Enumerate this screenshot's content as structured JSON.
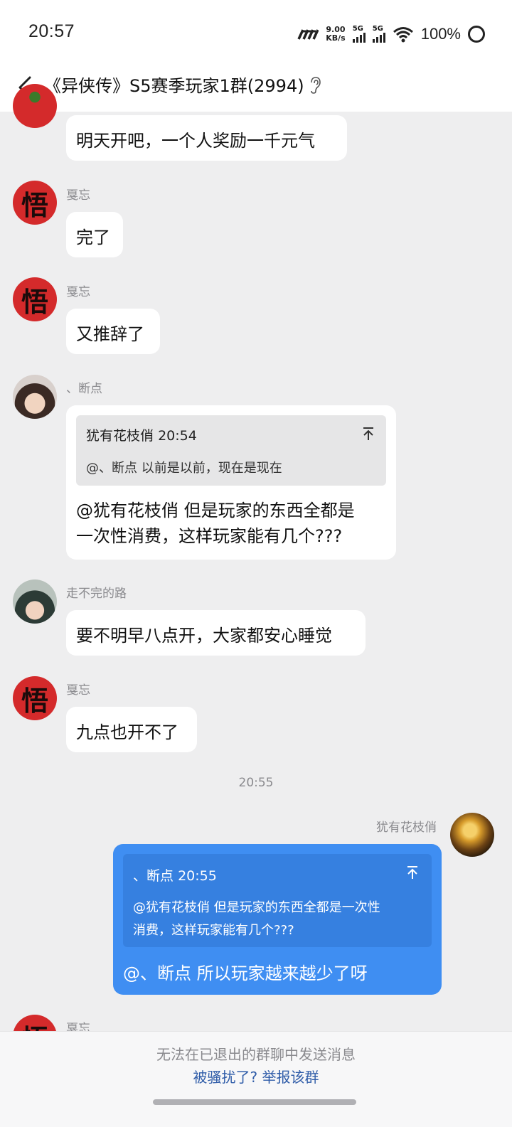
{
  "status_bar": {
    "time": "20:57",
    "net_speed_value": "9.00",
    "net_speed_unit": "KB/s",
    "sim1": "5G",
    "sim2": "5G",
    "battery": "100%"
  },
  "header": {
    "title": "《异侠传》S5赛季玩家1群(2994)",
    "icons": [
      "back-arrow-icon",
      "ear-icon"
    ]
  },
  "messages": [
    {
      "sender": "",
      "text": "明天开吧，一个人奖励一千元气"
    },
    {
      "sender": "戛忘",
      "avatar_char": "悟",
      "text": "完了"
    },
    {
      "sender": "戛忘",
      "avatar_char": "悟",
      "text": "又推辞了"
    },
    {
      "sender": "、断点",
      "quote": {
        "author": "犹有花枝俏",
        "time": "20:54",
        "text": "@、断点 以前是以前，现在是现在"
      },
      "text_line1": "@犹有花枝俏 但是玩家的东西全都是",
      "text_line2": "一次性消费，这样玩家能有几个???"
    },
    {
      "sender": "走不完的路",
      "text": "要不明早八点开，大家都安心睡觉"
    },
    {
      "sender": "戛忘",
      "avatar_char": "悟",
      "text": "九点也开不了"
    },
    {
      "timestamp": "20:55"
    },
    {
      "sender": "犹有花枝俏",
      "own": true,
      "quote": {
        "author": "、断点",
        "time": "20:55",
        "text_line1": "@犹有花枝俏 但是玩家的东西全都是一次性",
        "text_line2": "消费，这样玩家能有几个???"
      },
      "text": "@、断点 所以玩家越来越少了呀"
    },
    {
      "sender": "戛忘",
      "avatar_char": "悟"
    }
  ],
  "footer": {
    "notice": "无法在已退出的群聊中发送消息",
    "report_link": "被骚扰了? 举报该群"
  },
  "colors": {
    "own_bubble": "#3f8ef2",
    "avatar_red": "#d42a2b",
    "link": "#2f5ca8"
  }
}
